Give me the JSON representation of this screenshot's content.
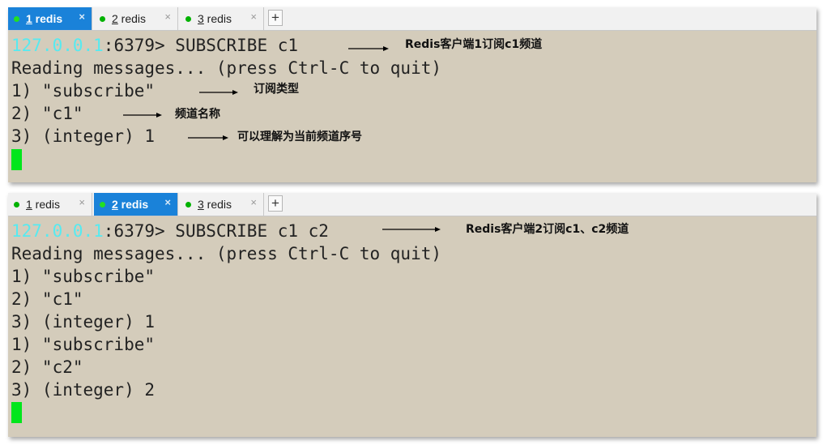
{
  "panel1": {
    "tabs": [
      {
        "num": "1",
        "label": " redis",
        "close": "×"
      },
      {
        "num": "2",
        "label": " redis",
        "close": "×"
      },
      {
        "num": "3",
        "label": " redis",
        "close": "×"
      }
    ],
    "add_label": "+",
    "prompt_host": "127.0.0.1",
    "prompt_rest": ":6379> SUBSCRIBE c1",
    "lines": [
      "Reading messages... (press Ctrl-C to quit)",
      "1) \"subscribe\"",
      "2) \"c1\"",
      "3) (integer) 1"
    ],
    "annotations": [
      "Redis客户端1订阅c1频道",
      "订阅类型",
      "频道名称",
      "可以理解为当前频道序号"
    ]
  },
  "panel2": {
    "tabs": [
      {
        "num": "1",
        "label": " redis",
        "close": "×"
      },
      {
        "num": "2",
        "label": " redis",
        "close": "×"
      },
      {
        "num": "3",
        "label": " redis",
        "close": "×"
      }
    ],
    "add_label": "+",
    "prompt_host": "127.0.0.1",
    "prompt_rest": ":6379> SUBSCRIBE c1 c2",
    "lines": [
      "Reading messages... (press Ctrl-C to quit)",
      "1) \"subscribe\"",
      "2) \"c1\"",
      "3) (integer) 1",
      "1) \"subscribe\"",
      "2) \"c2\"",
      "3) (integer) 2"
    ],
    "annotations": [
      "Redis客户端2订阅c1、c2频道"
    ]
  },
  "colors": {
    "active_tab": "#1a82d9",
    "terminal_bg": "#d4ccbb",
    "host_text": "#56eaf0",
    "cursor": "#00e61c",
    "status_dot": "#00b200"
  }
}
